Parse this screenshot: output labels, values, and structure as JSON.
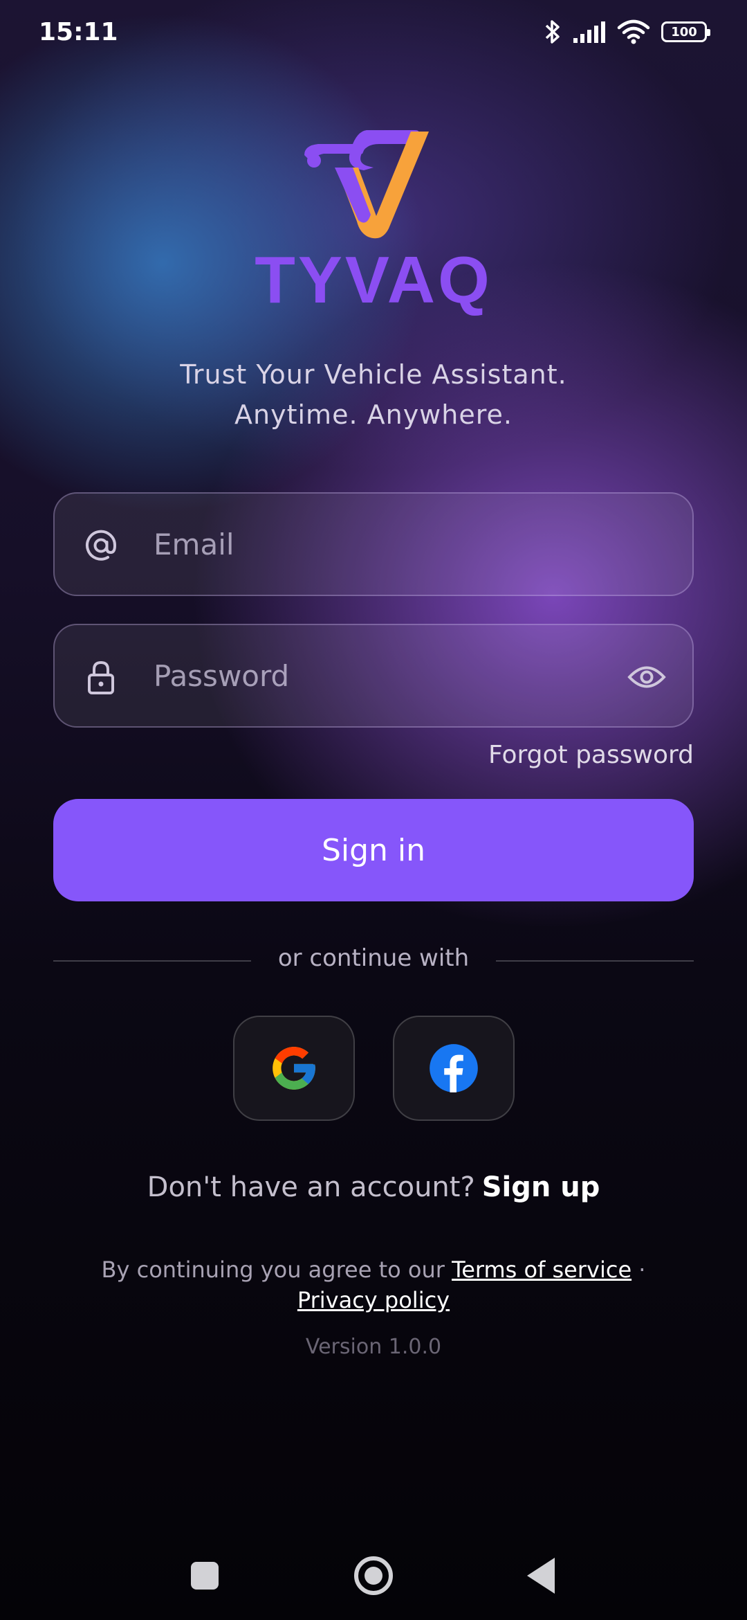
{
  "status_bar": {
    "time": "15:11",
    "battery": "100",
    "icons": [
      "bluetooth-icon",
      "signal-icon",
      "wifi-icon",
      "battery-icon"
    ]
  },
  "brand": {
    "name": "TYVAQ",
    "tagline_line1": "Trust Your Vehicle Assistant.",
    "tagline_line2": "Anytime. Anywhere.",
    "colors": {
      "purple": "#8b4ef2",
      "orange": "#f7a23b"
    }
  },
  "form": {
    "email_placeholder": "Email",
    "email_value": "",
    "password_placeholder": "Password",
    "password_value": "",
    "forgot_label": "Forgot password",
    "signin_label": "Sign in",
    "icons": {
      "email": "at-icon",
      "password": "lock-icon",
      "toggle": "eye-icon"
    }
  },
  "social": {
    "divider_text": "or continue with",
    "providers": [
      "google",
      "facebook"
    ]
  },
  "signup": {
    "prompt": "Don't have an account?",
    "link": "Sign up"
  },
  "legal": {
    "prefix": "By continuing you agree to our",
    "terms": "Terms of service",
    "separator": "·",
    "privacy": "Privacy policy"
  },
  "version": "Version 1.0.0",
  "colors": {
    "accent": "#8656fa",
    "background_dark": "#040307"
  }
}
